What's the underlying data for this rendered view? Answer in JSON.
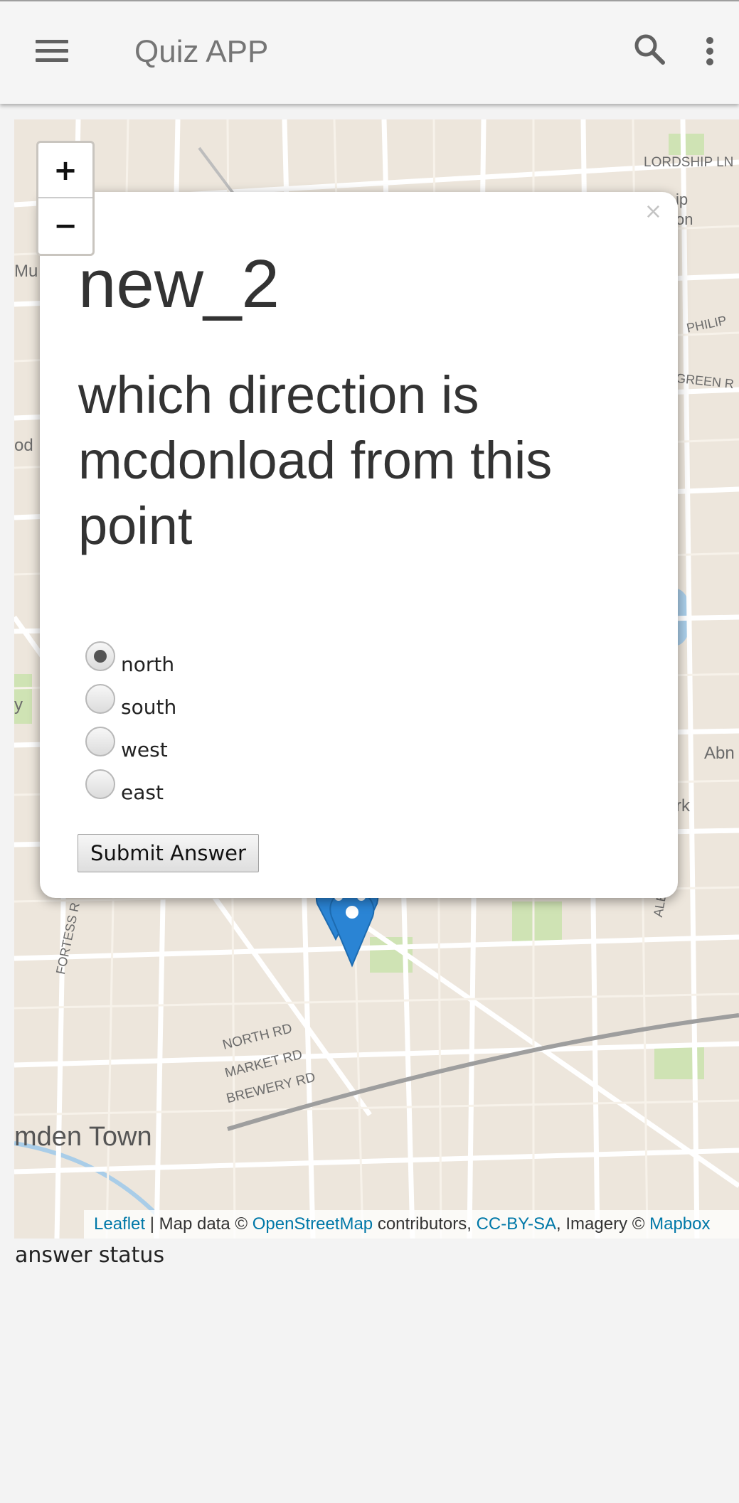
{
  "app_bar": {
    "title": "Quiz APP",
    "menu_icon": "hamburger-menu-icon",
    "search_icon": "search-icon",
    "more_icon": "more-vert-icon"
  },
  "map": {
    "zoom_in": "+",
    "zoom_out": "−",
    "labels": {
      "lordship": "LORDSHIP LN",
      "philip": "PHILIP",
      "green": "GREEN R",
      "abn": "Abn",
      "rk": "rk",
      "albion": "ALBION RD",
      "fortess": "FORTESS R",
      "north_rd": "NORTH RD",
      "market_rd": "MARKET RD",
      "brewery_rd": "BREWERY RD",
      "camden": "mden Town",
      "left_mu": "Mu",
      "left_od": "od",
      "left_y": "y",
      "right_ip": "ip",
      "right_on": "on"
    },
    "attribution": {
      "leaflet": "Leaflet",
      "sep": " | Map data © ",
      "osm": "OpenStreetMap",
      "contrib": " contributors, ",
      "license": "CC-BY-SA",
      "imagery": ", Imagery © ",
      "mapbox": "Mapbox"
    }
  },
  "popup": {
    "close": "×",
    "title": "new_2",
    "question": "which direction is mcdonload from this point",
    "options": [
      {
        "label": "north",
        "checked": true
      },
      {
        "label": "south",
        "checked": false
      },
      {
        "label": "west",
        "checked": false
      },
      {
        "label": "east",
        "checked": false
      }
    ],
    "submit_label": "Submit Answer"
  },
  "status_text": "answer status",
  "colors": {
    "marker": "#2a84d4",
    "link": "#0078a8",
    "map_bg": "#ede6dc"
  }
}
